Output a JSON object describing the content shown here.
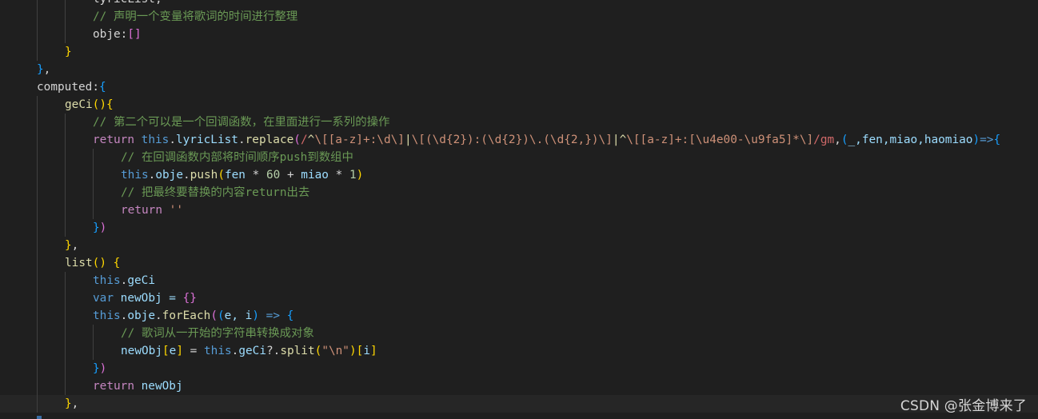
{
  "theme": {
    "background": "#1f1f1f",
    "colors": {
      "default": "#d4d4d4",
      "keyword": "#c586c0",
      "this": "#569cd6",
      "property": "#9cdcfe",
      "function": "#dcdcaa",
      "comment": "#6a9955",
      "string": "#ce9178",
      "regex": "#d16969",
      "regex_class": "#ce9178",
      "regex_anchor": "#dcdcaa",
      "number": "#b5cea8",
      "operator": "#d4d4d4",
      "bracket_gold": "#ffd700",
      "bracket_pink": "#da70d6",
      "bracket_blue": "#179fff"
    }
  },
  "editor": {
    "lines": [
      {
        "indent": 2,
        "tokens": [
          [
            "lyricList,",
            "default"
          ]
        ]
      },
      {
        "indent": 2,
        "tokens": [
          [
            "// 声明一个变量将歌词的时间进行整理",
            "comment"
          ]
        ]
      },
      {
        "indent": 2,
        "tokens": [
          [
            "obje",
            "default"
          ],
          [
            ":",
            "default"
          ],
          [
            "[]",
            "bracket_pink"
          ]
        ]
      },
      {
        "indent": 1,
        "tokens": [
          [
            "}",
            "bracket_gold"
          ]
        ]
      },
      {
        "indent": 0,
        "tokens": [
          [
            "}",
            "bracket_blue"
          ],
          [
            ",",
            "default"
          ]
        ]
      },
      {
        "indent": 0,
        "tokens": [
          [
            "computed",
            "default"
          ],
          [
            ":",
            "default"
          ],
          [
            "{",
            "bracket_blue"
          ]
        ]
      },
      {
        "indent": 1,
        "tokens": [
          [
            "geCi",
            "function"
          ],
          [
            "()",
            "bracket_gold"
          ],
          [
            "{",
            "bracket_gold"
          ]
        ]
      },
      {
        "indent": 2,
        "tokens": [
          [
            "// 第二个可以是一个回调函数，在里面进行一系列的操作",
            "comment"
          ]
        ]
      },
      {
        "indent": 2,
        "tokens": [
          [
            "return",
            "keyword"
          ],
          [
            " ",
            "default"
          ],
          [
            "this",
            "this"
          ],
          [
            ".",
            "default"
          ],
          [
            "lyricList",
            "property"
          ],
          [
            ".",
            "default"
          ],
          [
            "replace",
            "function"
          ],
          [
            "(",
            "bracket_pink"
          ],
          [
            "/",
            "regex"
          ],
          [
            "^",
            "regex_anchor"
          ],
          [
            "\\[[a-z]+:\\d\\]",
            "regex_class"
          ],
          [
            "|",
            "regex_anchor"
          ],
          [
            "\\[(\\d{2}):(\\d{2})\\.(\\d{2,})\\]",
            "regex_class"
          ],
          [
            "|",
            "regex_anchor"
          ],
          [
            "^",
            "regex_anchor"
          ],
          [
            "\\[[a-z]+:[\\u4e00-\\u9fa5]*\\]",
            "regex_class"
          ],
          [
            "/gm",
            "regex"
          ],
          [
            ",",
            "default"
          ],
          [
            "(",
            "bracket_blue"
          ],
          [
            "_,fen,miao,haomiao",
            "property"
          ],
          [
            ")",
            "bracket_blue"
          ],
          [
            "=>",
            "this"
          ],
          [
            "{",
            "bracket_blue"
          ]
        ]
      },
      {
        "indent": 3,
        "tokens": [
          [
            "// 在回调函数内部将时间顺序push到数组中",
            "comment"
          ]
        ]
      },
      {
        "indent": 3,
        "tokens": [
          [
            "this",
            "this"
          ],
          [
            ".",
            "default"
          ],
          [
            "obje",
            "property"
          ],
          [
            ".",
            "default"
          ],
          [
            "push",
            "function"
          ],
          [
            "(",
            "bracket_gold"
          ],
          [
            "fen ",
            "property"
          ],
          [
            "* ",
            "default"
          ],
          [
            "60",
            "number"
          ],
          [
            " + ",
            "default"
          ],
          [
            "miao ",
            "property"
          ],
          [
            "* ",
            "default"
          ],
          [
            "1",
            "number"
          ],
          [
            ")",
            "bracket_gold"
          ]
        ]
      },
      {
        "indent": 3,
        "tokens": [
          [
            "// 把最终要替换的内容return出去",
            "comment"
          ]
        ]
      },
      {
        "indent": 3,
        "tokens": [
          [
            "return",
            "keyword"
          ],
          [
            " ",
            "default"
          ],
          [
            "''",
            "string"
          ]
        ]
      },
      {
        "indent": 2,
        "tokens": [
          [
            "}",
            "bracket_blue"
          ],
          [
            ")",
            "bracket_pink"
          ]
        ]
      },
      {
        "indent": 1,
        "tokens": [
          [
            "}",
            "bracket_gold"
          ],
          [
            ",",
            "default"
          ]
        ]
      },
      {
        "indent": 1,
        "tokens": [
          [
            "list",
            "function"
          ],
          [
            "()",
            "bracket_gold"
          ],
          [
            " ",
            "default"
          ],
          [
            "{",
            "bracket_gold"
          ]
        ]
      },
      {
        "indent": 2,
        "tokens": [
          [
            "this",
            "this"
          ],
          [
            ".",
            "default"
          ],
          [
            "geCi",
            "property"
          ]
        ]
      },
      {
        "indent": 2,
        "tokens": [
          [
            "var",
            "this"
          ],
          [
            " newObj = ",
            "property"
          ],
          [
            "{}",
            "bracket_pink"
          ]
        ]
      },
      {
        "indent": 2,
        "tokens": [
          [
            "this",
            "this"
          ],
          [
            ".",
            "default"
          ],
          [
            "obje",
            "property"
          ],
          [
            ".",
            "default"
          ],
          [
            "forEach",
            "function"
          ],
          [
            "(",
            "bracket_pink"
          ],
          [
            "(",
            "bracket_blue"
          ],
          [
            "e, i",
            "property"
          ],
          [
            ")",
            "bracket_blue"
          ],
          [
            " ",
            "default"
          ],
          [
            "=>",
            "this"
          ],
          [
            " ",
            "default"
          ],
          [
            "{",
            "bracket_blue"
          ]
        ]
      },
      {
        "indent": 3,
        "tokens": [
          [
            "// 歌词从一开始的字符串转换成对象",
            "comment"
          ]
        ]
      },
      {
        "indent": 3,
        "tokens": [
          [
            "newObj",
            "property"
          ],
          [
            "[",
            "bracket_gold"
          ],
          [
            "e",
            "property"
          ],
          [
            "]",
            "bracket_gold"
          ],
          [
            " = ",
            "default"
          ],
          [
            "this",
            "this"
          ],
          [
            ".",
            "default"
          ],
          [
            "geCi",
            "property"
          ],
          [
            "?.",
            "default"
          ],
          [
            "split",
            "function"
          ],
          [
            "(",
            "bracket_gold"
          ],
          [
            "\"\\n\"",
            "string"
          ],
          [
            ")",
            "bracket_gold"
          ],
          [
            "[",
            "bracket_gold"
          ],
          [
            "i",
            "property"
          ],
          [
            "]",
            "bracket_gold"
          ]
        ]
      },
      {
        "indent": 2,
        "tokens": [
          [
            "}",
            "bracket_blue"
          ],
          [
            ")",
            "bracket_pink"
          ]
        ]
      },
      {
        "indent": 2,
        "tokens": [
          [
            "return",
            "keyword"
          ],
          [
            " newObj",
            "property"
          ]
        ]
      },
      {
        "indent": 1,
        "tokens": [
          [
            "}",
            "bracket_gold"
          ],
          [
            ",",
            "default"
          ]
        ]
      }
    ]
  },
  "watermark": {
    "text": "CSDN @张金博来了"
  }
}
